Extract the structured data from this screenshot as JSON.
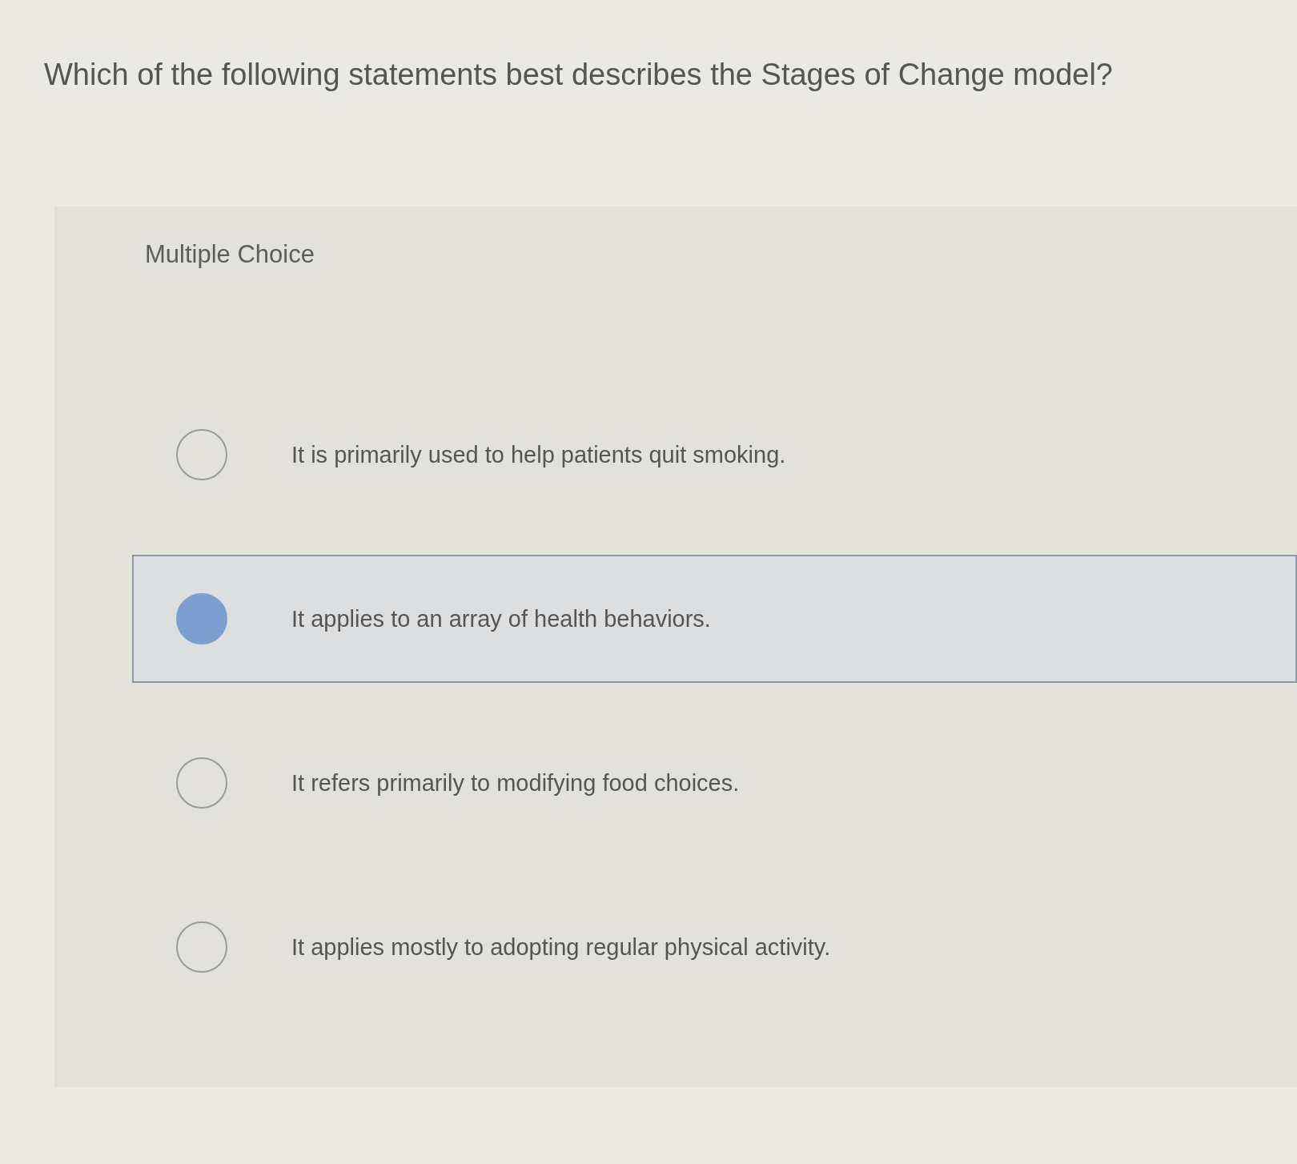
{
  "question": "Which of the following statements best describes the Stages of Change model?",
  "question_type": "Multiple Choice",
  "options": [
    {
      "text": "It is primarily used to help patients quit smoking.",
      "selected": false
    },
    {
      "text": "It applies to an array of health behaviors.",
      "selected": true
    },
    {
      "text": "It refers primarily to modifying food choices.",
      "selected": false
    },
    {
      "text": "It applies mostly to adopting regular physical activity.",
      "selected": false
    }
  ]
}
